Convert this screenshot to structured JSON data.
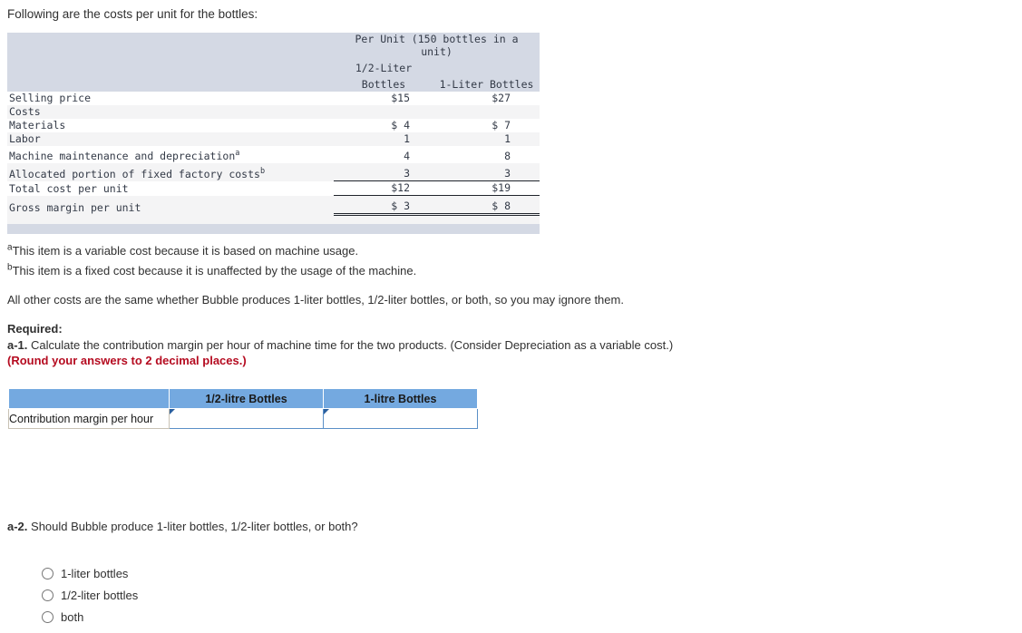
{
  "intro": "Following are the costs per unit for the bottles:",
  "cost_table": {
    "header_span": "Per Unit (150 bottles in a",
    "header_span_2": "unit)",
    "col_a_line1": "1/2-Liter",
    "col_a_line2": "Bottles",
    "col_b": "1-Liter Bottles",
    "rows": [
      {
        "label": "Selling price",
        "a": "$15",
        "b": "$27"
      },
      {
        "label": "Costs",
        "a": "",
        "b": ""
      },
      {
        "label": "Materials",
        "a": "$ 4",
        "b": "$ 7"
      },
      {
        "label": "Labor",
        "a": "1",
        "b": "1"
      },
      {
        "label": "Machine maintenance and depreciation",
        "sup": "a",
        "a": "4",
        "b": "8"
      },
      {
        "label": "Allocated portion of fixed factory costs",
        "sup": "b",
        "a": "3",
        "b": "3"
      },
      {
        "label": "Total cost per unit",
        "a": "$12",
        "b": "$19"
      },
      {
        "label": "Gross margin per unit",
        "a": "$ 3",
        "b": "$ 8"
      }
    ]
  },
  "footnotes": {
    "a_marker": "a",
    "a_text": "This item is a variable cost because it is based on machine usage.",
    "b_marker": "b",
    "b_text": "This item is a fixed cost because it is unaffected by the usage of the machine."
  },
  "all_other_costs": "All other costs are the same whether Bubble produces 1-liter bottles, 1/2-liter bottles, or both, so you may ignore them.",
  "required_label": "Required:",
  "question_a1": {
    "number": "a-1.",
    "text": " Calculate the contribution margin per hour of machine time for the two products. (Consider Depreciation as a variable cost.)",
    "round_note": "(Round your answers to 2 decimal places.)"
  },
  "answer_table": {
    "col_blank": "",
    "col_half_litre": "1/2-litre Bottles",
    "col_one_litre": "1-litre Bottles",
    "row_label": "Contribution margin per hour",
    "value_half_litre": "",
    "value_one_litre": ""
  },
  "question_a2": {
    "number": "a-2.",
    "text": " Should Bubble produce 1-liter bottles, 1/2-liter bottles, or both?",
    "options": [
      "1-liter bottles",
      "1/2-liter bottles",
      "both"
    ]
  },
  "colors": {
    "table_header_band": "#d4d9e4",
    "table_stripe": "#f4f4f5",
    "answer_header_blue": "#74a9e0",
    "input_border_blue": "#5a8fc7",
    "marker_triangle_blue": "#2a5f9e",
    "required_red": "#b50b20"
  }
}
